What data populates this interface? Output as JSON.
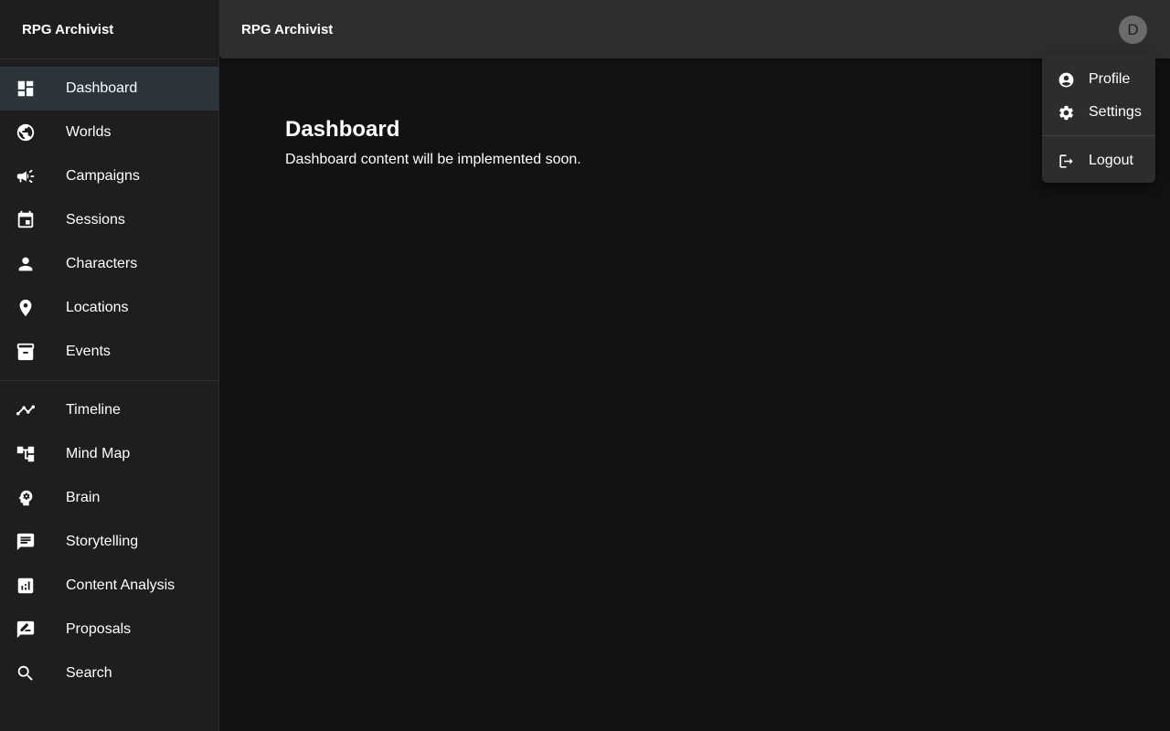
{
  "app": {
    "title": "RPG Archivist"
  },
  "topbar": {
    "title": "RPG Archivist",
    "avatar_letter": "D"
  },
  "sidebar": {
    "items": [
      {
        "label": "Dashboard",
        "icon": "dashboard-icon",
        "active": true
      },
      {
        "label": "Worlds",
        "icon": "globe-icon"
      },
      {
        "label": "Campaigns",
        "icon": "campaign-icon"
      },
      {
        "label": "Sessions",
        "icon": "calendar-icon"
      },
      {
        "label": "Characters",
        "icon": "person-icon"
      },
      {
        "label": "Locations",
        "icon": "location-pin-icon"
      },
      {
        "label": "Events",
        "icon": "archive-icon"
      }
    ],
    "tools": [
      {
        "label": "Timeline",
        "icon": "timeline-icon"
      },
      {
        "label": "Mind Map",
        "icon": "account-tree-icon"
      },
      {
        "label": "Brain",
        "icon": "brain-icon"
      },
      {
        "label": "Storytelling",
        "icon": "chat-icon"
      },
      {
        "label": "Content Analysis",
        "icon": "analytics-icon"
      },
      {
        "label": "Proposals",
        "icon": "rate-review-icon"
      },
      {
        "label": "Search",
        "icon": "search-icon"
      }
    ]
  },
  "main": {
    "title": "Dashboard",
    "text": "Dashboard content will be implemented soon."
  },
  "user_menu": {
    "profile": "Profile",
    "settings": "Settings",
    "logout": "Logout"
  }
}
